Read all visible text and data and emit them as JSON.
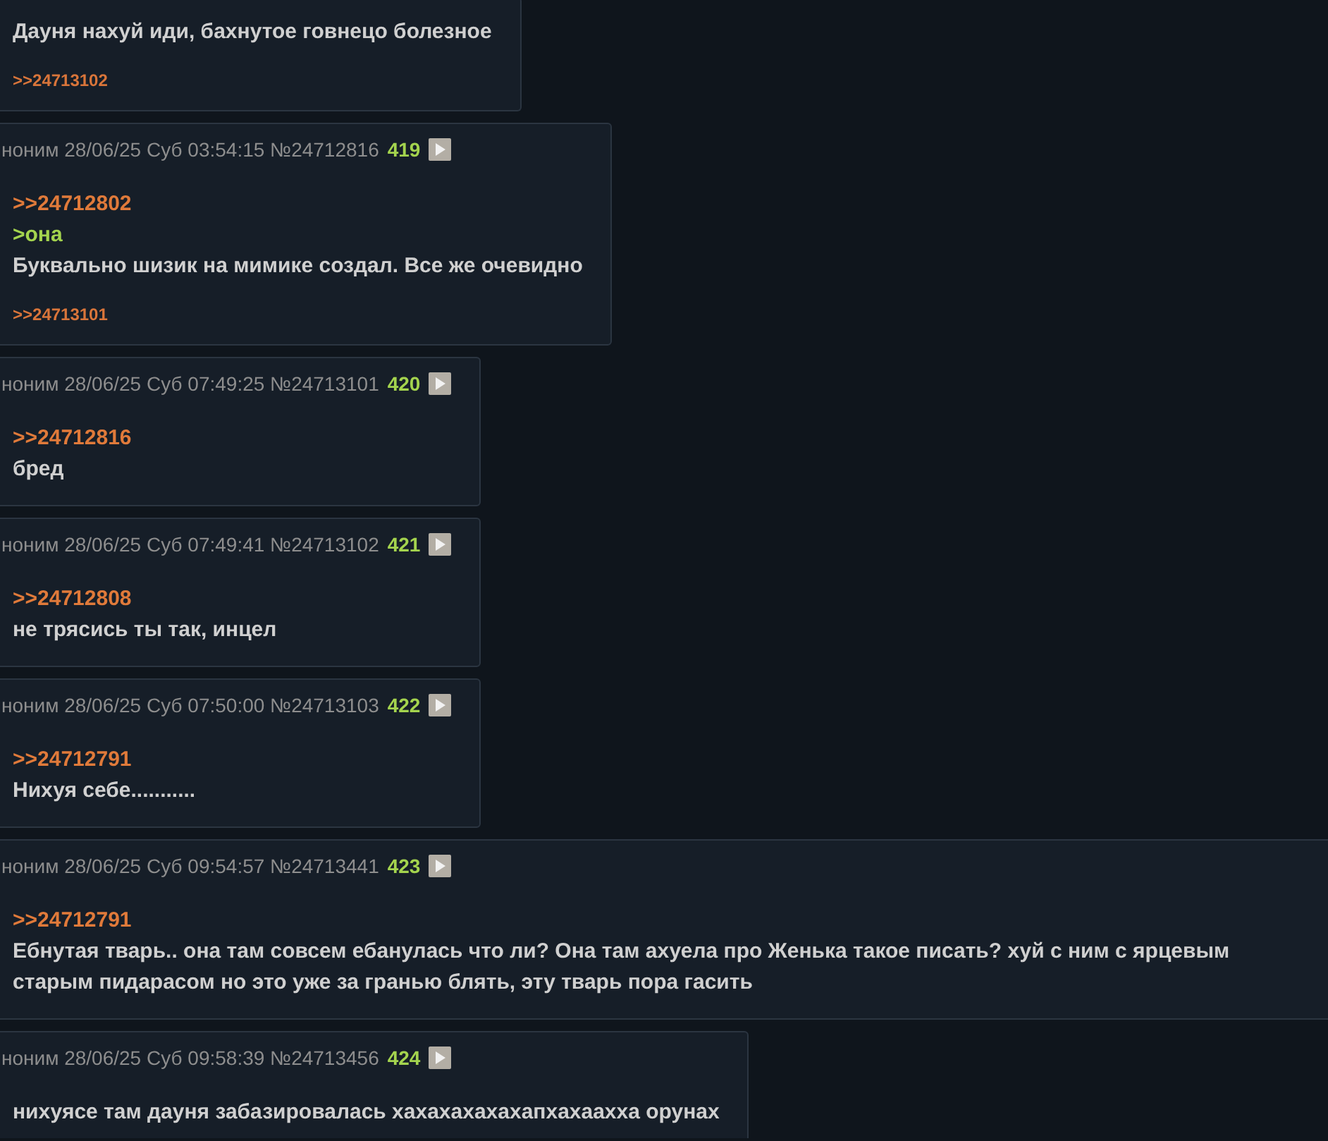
{
  "posts": [
    {
      "wide": false,
      "lines": [
        {
          "kind": "text",
          "text": "Дауня нахуй иди, бахнутое говнецо болезное"
        }
      ],
      "backlinks": [
        ">>24713102"
      ]
    },
    {
      "header": {
        "name": "ноним",
        "date": "28/06/25 Суб 03:54:15",
        "id": "№24712816",
        "count": "419"
      },
      "wide": false,
      "lines": [
        {
          "kind": "reply",
          "text": ">>24712802"
        },
        {
          "kind": "quote",
          "text": ">она"
        },
        {
          "kind": "text",
          "text": "Буквально шизик на мимике создал. Все же очевидно"
        }
      ],
      "backlinks": [
        ">>24713101"
      ]
    },
    {
      "header": {
        "name": "ноним",
        "date": "28/06/25 Суб 07:49:25",
        "id": "№24713101",
        "count": "420"
      },
      "wide": false,
      "lines": [
        {
          "kind": "reply",
          "text": ">>24712816"
        },
        {
          "kind": "text",
          "text": "бред"
        }
      ]
    },
    {
      "header": {
        "name": "ноним",
        "date": "28/06/25 Суб 07:49:41",
        "id": "№24713102",
        "count": "421"
      },
      "wide": false,
      "lines": [
        {
          "kind": "reply",
          "text": ">>24712808"
        },
        {
          "kind": "text",
          "text": "не трясись ты так, инцел"
        }
      ]
    },
    {
      "header": {
        "name": "ноним",
        "date": "28/06/25 Суб 07:50:00",
        "id": "№24713103",
        "count": "422"
      },
      "wide": false,
      "lines": [
        {
          "kind": "reply",
          "text": ">>24712791"
        },
        {
          "kind": "text",
          "text": "Нихуя себе..........."
        }
      ]
    },
    {
      "header": {
        "name": "ноним",
        "date": "28/06/25 Суб 09:54:57",
        "id": "№24713441",
        "count": "423"
      },
      "wide": true,
      "lines": [
        {
          "kind": "reply",
          "text": ">>24712791"
        },
        {
          "kind": "text",
          "text": "Ебнутая тварь.. она там совсем ебанулась что ли? Она там ахуела про Женька такое писать? хуй с ним с ярцевым старым пидарасом но это уже за гранью блять, эту тварь пора гасить"
        }
      ]
    },
    {
      "header": {
        "name": "ноним",
        "date": "28/06/25 Суб 09:58:39",
        "id": "№24713456",
        "count": "424"
      },
      "wide": false,
      "lines": [
        {
          "kind": "text",
          "text": "нихуясе там дауня забазировалась хахахахахахапхахаахха орунах"
        }
      ]
    }
  ]
}
